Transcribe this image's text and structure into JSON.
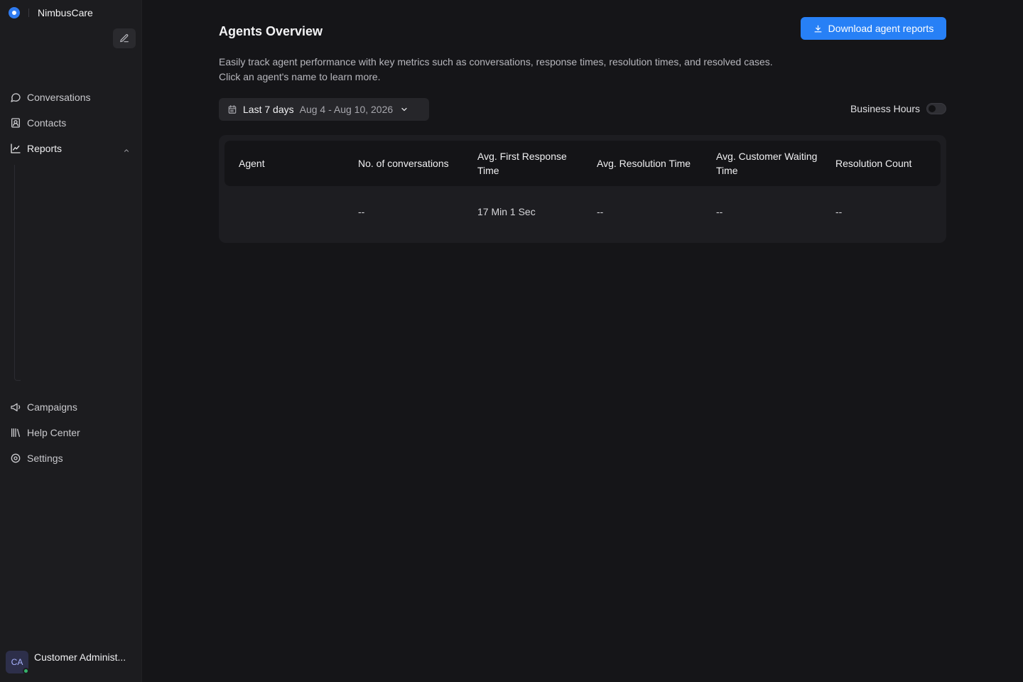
{
  "sidebar": {
    "brand_name": "NimbusCare",
    "nav": {
      "conversations": "Conversations",
      "contacts": "Contacts",
      "reports": "Reports",
      "campaigns": "Campaigns",
      "help_center": "Help Center",
      "settings": "Settings"
    },
    "user": {
      "initials": "CA",
      "name": "Customer Administ...",
      "status": "online"
    }
  },
  "main": {
    "title": "Agents Overview",
    "download_label": "Download agent reports",
    "description": "Easily track agent performance with key metrics such as conversations, response times, resolution times, and resolved cases. Click an agent's name to learn more.",
    "date_range": {
      "label": "Last 7 days",
      "dates": "Aug 4 - Aug 10, 2026"
    },
    "business_hours": {
      "label": "Business Hours",
      "enabled": false
    },
    "table": {
      "columns": [
        "Agent",
        "No. of conversations",
        "Avg. First Response Time",
        "Avg. Resolution Time",
        "Avg. Customer Waiting Time",
        "Resolution Count"
      ],
      "rows": [
        [
          "",
          "--",
          "17 Min 1 Sec",
          "--",
          "--",
          "--"
        ]
      ]
    }
  },
  "colors": {
    "accent": "#2780f6",
    "background": "#151518",
    "sidebar": "#1c1c1f",
    "online": "#35b36b"
  }
}
